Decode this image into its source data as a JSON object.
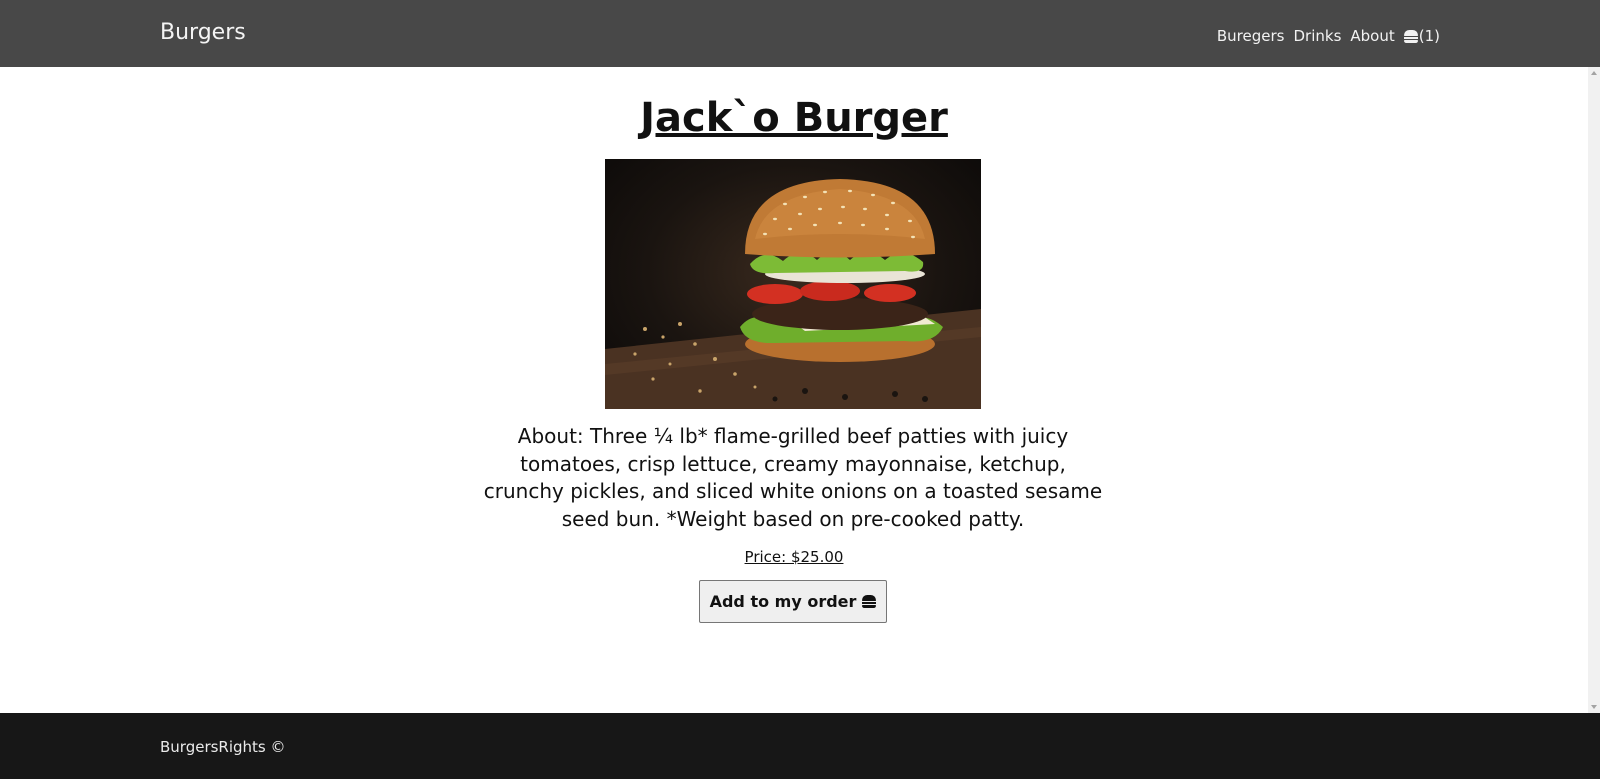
{
  "header": {
    "brand": "Burgers",
    "nav": {
      "burgers": "Buregers",
      "drinks": "Drinks",
      "about": "About",
      "cart_count": "(1)"
    }
  },
  "product": {
    "title": "Jack`o Burger",
    "image_alt": "Jack`o Burger",
    "about": "About: Three ¼ lb* flame-grilled beef patties with juicy tomatoes, crisp lettuce, creamy mayonnaise, ketchup, crunchy pickles, and sliced white onions on a toasted sesame seed bun. *Weight based on pre-cooked patty.",
    "price": "Price: $25.00",
    "add_button": "Add to my order"
  },
  "footer": {
    "text": "BurgersRights ©"
  },
  "colors": {
    "header_bg": "#484848",
    "footer_bg": "#171717",
    "button_bg": "#efefef"
  },
  "icons": {
    "cart": "burger-icon",
    "add_button": "burger-icon"
  }
}
